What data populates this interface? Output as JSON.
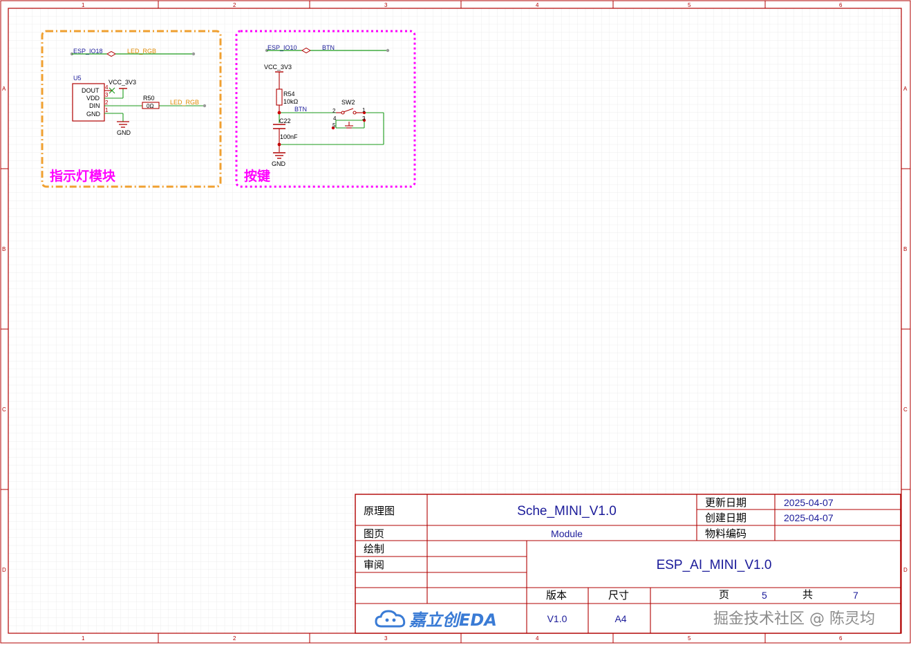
{
  "frame": {
    "columns": [
      "1",
      "2",
      "3",
      "4",
      "5",
      "6"
    ],
    "rows": [
      "A",
      "B",
      "C",
      "D"
    ],
    "border_color": "#b00000",
    "grid_color": "#e6e6e6"
  },
  "led_module": {
    "title": "指示灯模块",
    "frame_color": "#f0a030",
    "title_color": "#ff00ff",
    "net_left": "ESP_IO18",
    "net_right": "LED_RGB",
    "component_ref": "U5",
    "pins": [
      "DOUT",
      "VDD",
      "DIN",
      "GND"
    ],
    "pin_numbers": [
      "4",
      "3",
      "2",
      "1"
    ],
    "power": "VCC_3V3",
    "resistor_ref": "R50",
    "resistor_value": "0Ω",
    "resistor_net": "LED_RGB",
    "ground": "GND"
  },
  "button_module": {
    "title": "按键",
    "frame_color": "#ff00ff",
    "title_color": "#ff00ff",
    "net_left": "ESP_IO10",
    "net_right": "BTN",
    "power": "VCC_3V3",
    "resistor_ref": "R54",
    "resistor_value": "10kΩ",
    "node_net": "BTN",
    "switch_ref": "SW2",
    "switch_pins": [
      "2",
      "1",
      "4",
      "3",
      "5"
    ],
    "capacitor_ref": "C22",
    "capacitor_value": "100nF",
    "ground": "GND"
  },
  "title_block": {
    "doc_type": "原理图",
    "sheet_name": "Sche_MINI_V1.0",
    "updated_label": "更新日期",
    "updated_value": "2025-04-07",
    "created_label": "创建日期",
    "created_value": "2025-04-07",
    "page_label": "图页",
    "page_value": "Module",
    "part_code_label": "物料编码",
    "drawn_label": "绘制",
    "review_label": "审阅",
    "project_name": "ESP_AI_MINI_V1.0",
    "version_label": "版本",
    "size_label": "尺寸",
    "page_num_label": "页",
    "page_num": "5",
    "total_label": "共",
    "total": "7",
    "version_value": "V1.0",
    "size_value": "A4",
    "logo_text": "嘉立创EDA"
  },
  "watermark": "掘金技术社区 @ 陈灵均"
}
